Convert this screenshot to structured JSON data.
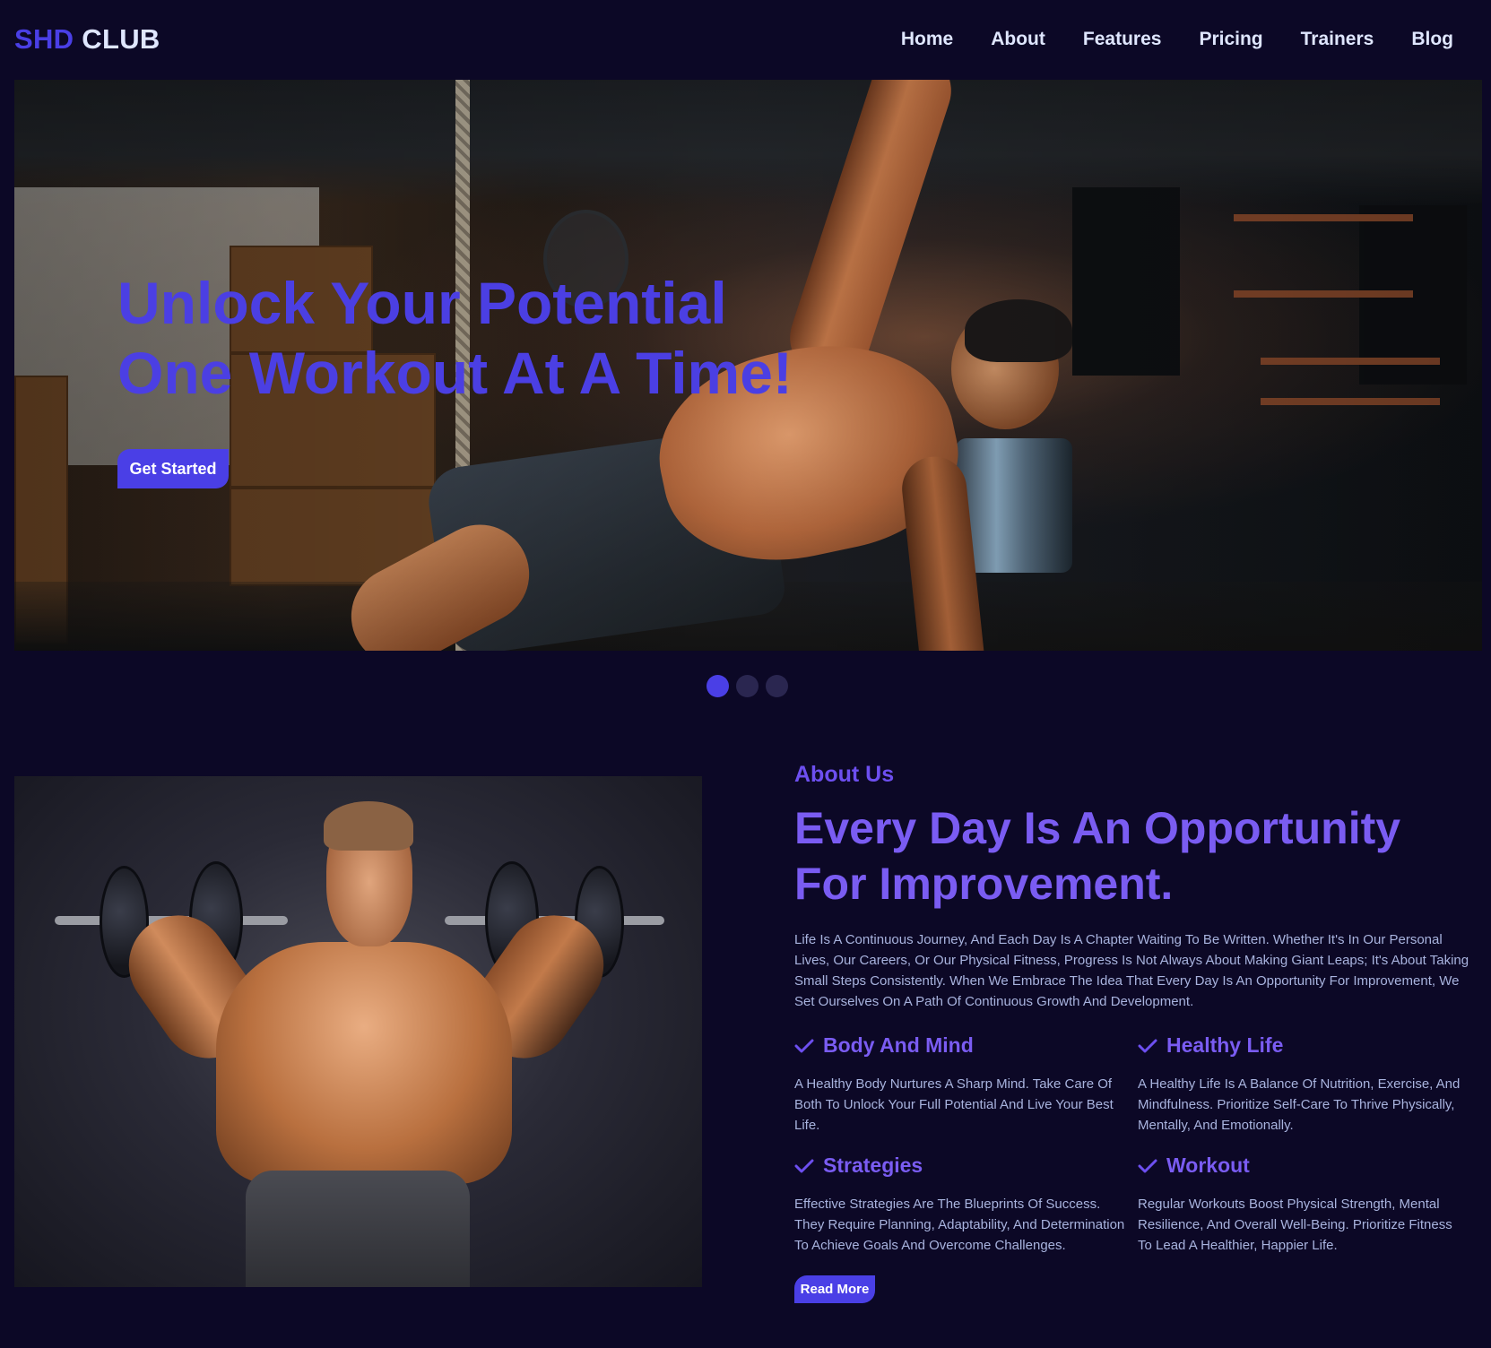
{
  "nav": {
    "logo_brand": "SHD",
    "logo_rest": "CLUB",
    "links": [
      "Home",
      "About",
      "Features",
      "Pricing",
      "Trainers",
      "Blog"
    ]
  },
  "hero": {
    "title_line1": "Unlock Your Potential",
    "title_line2": "One Workout At A Time!",
    "cta_label": "Get Started",
    "slides_total": 3,
    "active_slide": 1
  },
  "about": {
    "kicker": "About Us",
    "title": "Every Day Is An Opportunity For Improvement.",
    "paragraph": "Life Is A Continuous Journey, And Each Day Is A Chapter Waiting To Be Written. Whether It's In Our Personal Lives, Our Careers, Or Our Physical Fitness, Progress Is Not Always About Making Giant Leaps; It's About Taking Small Steps Consistently. When We Embrace The Idea That Every Day Is An Opportunity For Improvement, We Set Ourselves On A Path Of Continuous Growth And Development.",
    "features": [
      {
        "title": "Body And Mind",
        "desc": "A Healthy Body Nurtures A Sharp Mind. Take Care Of Both To Unlock Your Full Potential And Live Your Best Life."
      },
      {
        "title": "Healthy Life",
        "desc": "A Healthy Life Is A Balance Of Nutrition, Exercise, And Mindfulness. Prioritize Self-Care To Thrive Physically, Mentally, And Emotionally."
      },
      {
        "title": "Strategies",
        "desc": "Effective Strategies Are The Blueprints Of Success. They Require Planning, Adaptability, And Determination To Achieve Goals And Overcome Challenges."
      },
      {
        "title": "Workout",
        "desc": "Regular Workouts Boost Physical Strength, Mental Resilience, And Overall Well-Being. Prioritize Fitness To Lead A Healthier, Happier Life."
      }
    ],
    "read_more_label": "Read More"
  },
  "colors": {
    "background": "#0c0826",
    "accent": "#4a3fe6",
    "heading_purple": "#7a5cf2",
    "body_text": "#a8b3de"
  },
  "icons": {
    "feature_icon": "check-icon"
  }
}
